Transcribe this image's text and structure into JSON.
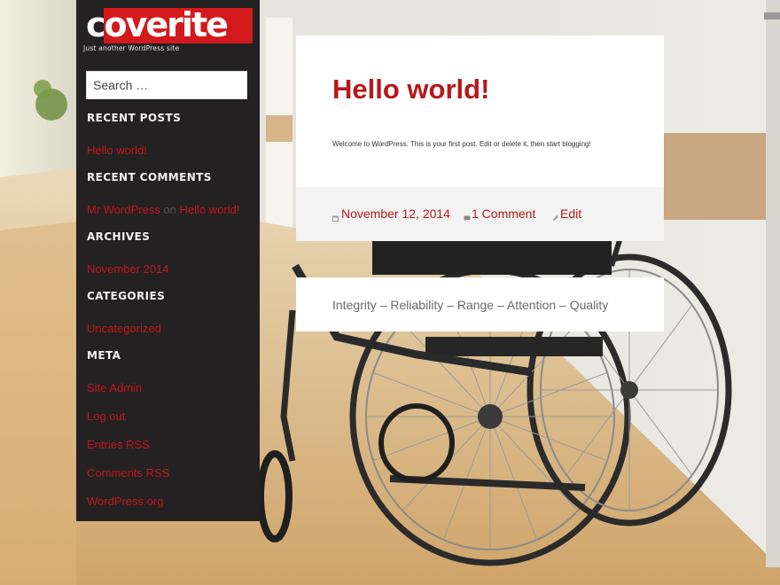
{
  "site": {
    "logo_text": "coverite",
    "tagline": "Just another WordPress site"
  },
  "search": {
    "placeholder": "Search …"
  },
  "widgets": {
    "recent_posts": {
      "title": "RECENT POSTS",
      "items": [
        "Hello world!"
      ]
    },
    "recent_comments": {
      "title": "RECENT COMMENTS",
      "author": "Mr WordPress",
      "on": "on",
      "post": "Hello world!"
    },
    "archives": {
      "title": "ARCHIVES",
      "items": [
        "November 2014"
      ]
    },
    "categories": {
      "title": "CATEGORIES",
      "items": [
        "Uncategorized"
      ]
    },
    "meta": {
      "title": "META",
      "items": [
        "Site Admin",
        "Log out",
        "Entries RSS",
        "Comments RSS",
        "WordPress.org"
      ]
    }
  },
  "post": {
    "title": "Hello world!",
    "body": "Welcome to WordPress. This is your first post. Edit or delete it, then start blogging!",
    "date": "November 12, 2014",
    "comments": "1 Comment",
    "edit": "Edit"
  },
  "footer_tagline": "Integrity – Reliability – Range – Attention – Quality",
  "colors": {
    "accent": "#b8171b",
    "sidebar_bg": "#232122",
    "logo_red": "#d3191c"
  },
  "icons": {
    "date": "calendar-icon",
    "comments": "comment-icon",
    "edit": "pencil-icon"
  }
}
